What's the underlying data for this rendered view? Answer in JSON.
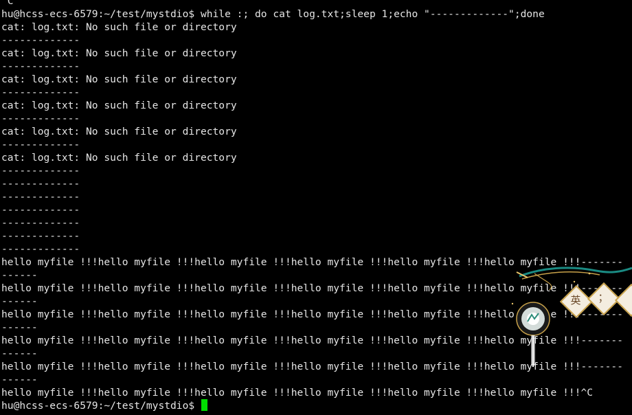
{
  "terminal": {
    "lines": [
      "^C",
      "hu@hcss-ecs-6579:~/test/mystdio$ while :; do cat log.txt;sleep 1;echo \"-------------\";done",
      "cat: log.txt: No such file or directory",
      "-------------",
      "cat: log.txt: No such file or directory",
      "-------------",
      "cat: log.txt: No such file or directory",
      "-------------",
      "cat: log.txt: No such file or directory",
      "-------------",
      "cat: log.txt: No such file or directory",
      "-------------",
      "cat: log.txt: No such file or directory",
      "-------------",
      "-------------",
      "-------------",
      "-------------",
      "-------------",
      "-------------",
      "-------------",
      "hello myfile !!!hello myfile !!!hello myfile !!!hello myfile !!!hello myfile !!!hello myfile !!!-------",
      "------",
      "hello myfile !!!hello myfile !!!hello myfile !!!hello myfile !!!hello myfile !!!hello myfile !!!-------",
      "------",
      "hello myfile !!!hello myfile !!!hello myfile !!!hello myfile !!!hello myfile !!!hello myfile !!!-------",
      "------",
      "hello myfile !!!hello myfile !!!hello myfile !!!hello myfile !!!hello myfile !!!hello myfile !!!-------",
      "------",
      "hello myfile !!!hello myfile !!!hello myfile !!!hello myfile !!!hello myfile !!!hello myfile !!!-------",
      "------",
      "hello myfile !!!hello myfile !!!hello myfile !!!hello myfile !!!hello myfile !!!hello myfile !!!^C"
    ],
    "prompt": "hu@hcss-ecs-6579:~/test/mystdio$ ",
    "colors": {
      "background": "#000000",
      "foreground": "#e6e6e6",
      "cursor": "#00e000"
    }
  },
  "ime_widget": {
    "icon": "ime-toolbar-icon",
    "mode_label": "英",
    "punct_label": "；"
  }
}
